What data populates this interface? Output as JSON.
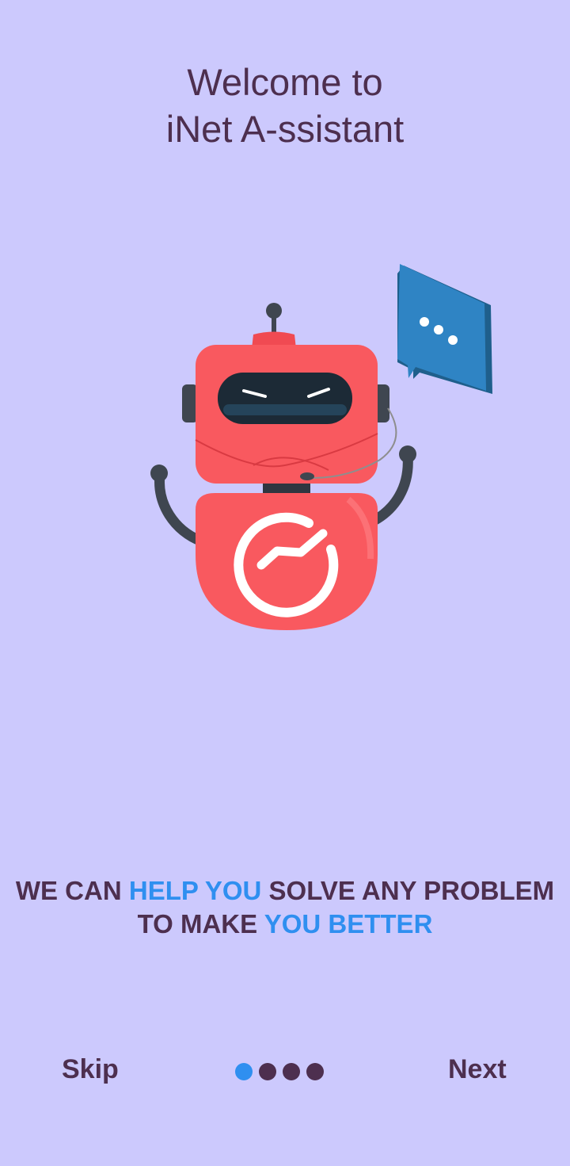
{
  "header": {
    "title_line1": "Welcome to",
    "title_line2": "iNet A-ssistant"
  },
  "illustration": {
    "icon": "robot-assistant-icon",
    "bubble_icon": "chat-bubble-icon"
  },
  "tagline": {
    "part1": "WE CAN ",
    "part2": "HELP YOU",
    "part3": " SOLVE ANY PROBLEM",
    "part4": "TO MAKE ",
    "part5": "YOU BETTER"
  },
  "nav": {
    "skip_label": "Skip",
    "next_label": "Next",
    "page_count": 4,
    "current_page": 1
  },
  "colors": {
    "background": "#ccc9fd",
    "text": "#4d2f4f",
    "accent": "#2f8ff0",
    "robot_red": "#f9595f",
    "bubble_blue": "#2f84c4"
  }
}
